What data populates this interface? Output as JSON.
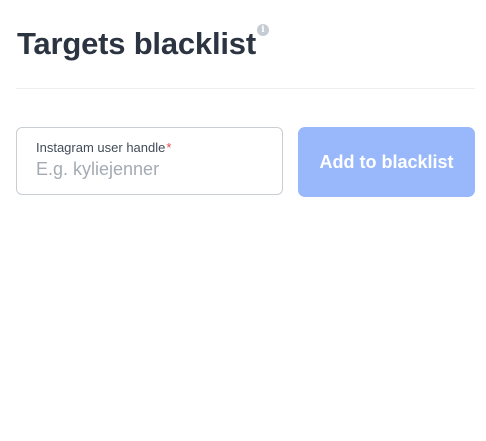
{
  "header": {
    "title": "Targets blacklist",
    "info_icon": "info-icon",
    "info_icon_glyph": "i"
  },
  "form": {
    "field_label": "Instagram user handle",
    "required_mark": "*",
    "input_value": "",
    "input_placeholder": "E.g. kyliejenner",
    "submit_label": "Add to blacklist",
    "submit_state": "disabled"
  },
  "colors": {
    "title_text": "#2b3440",
    "button_background": "#99b8fb",
    "required_mark": "#e5484d",
    "field_border": "#c9ced4"
  }
}
